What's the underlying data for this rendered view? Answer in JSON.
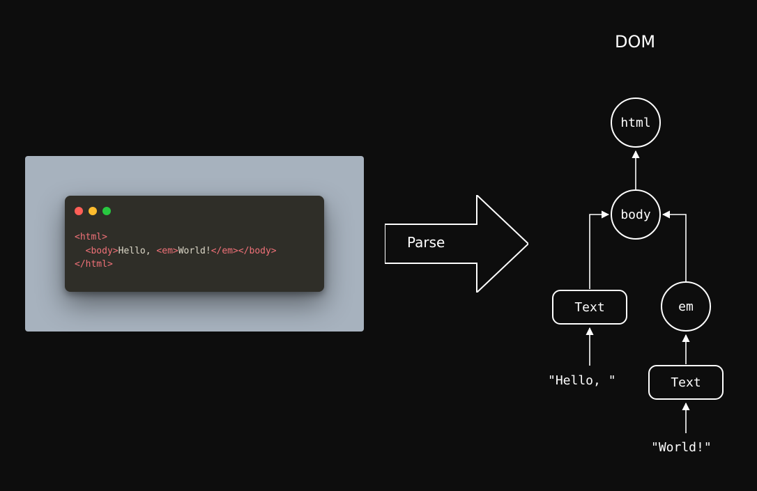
{
  "title": "DOM",
  "arrow_label": "Parse",
  "code": {
    "lines": [
      [
        {
          "cls": "t-tag",
          "text": "<html>"
        }
      ],
      [
        {
          "cls": "t-txt",
          "text": "  "
        },
        {
          "cls": "t-tag",
          "text": "<body>"
        },
        {
          "cls": "t-txt",
          "text": "Hello, "
        },
        {
          "cls": "t-tag",
          "text": "<em>"
        },
        {
          "cls": "t-txt",
          "text": "World!"
        },
        {
          "cls": "t-tag",
          "text": "</em>"
        },
        {
          "cls": "t-tag",
          "text": "</body>"
        }
      ],
      [
        {
          "cls": "t-tag",
          "text": "</html>"
        }
      ]
    ]
  },
  "tree": {
    "html": "html",
    "body": "body",
    "text1": "Text",
    "em": "em",
    "text2": "Text",
    "hello": "\"Hello, \"",
    "world": "\"World!\""
  }
}
